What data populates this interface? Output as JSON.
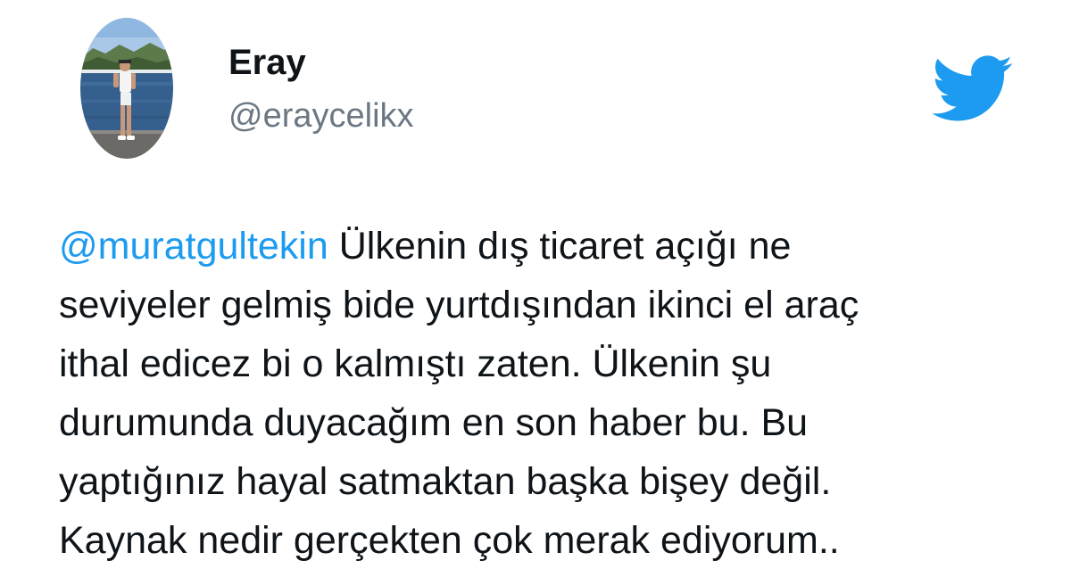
{
  "author": {
    "display_name": "Eray",
    "handle": "@eraycelikx",
    "avatar": "profile-photo"
  },
  "logo": {
    "icon": "twitter-bird-icon",
    "color": "#1d9bf0"
  },
  "tweet": {
    "mention": "@muratgultekin",
    "mention_color": "#1d9bf0",
    "lines": [
      " Ülkenin dış ticaret açığı ne",
      "seviyeler gelmiş bide yurtdışından ikinci el araç",
      "ithal edicez bi o kalmıştı zaten. Ülkenin şu",
      "durumunda duyacağım en son haber bu. Bu",
      "yaptığınız hayal satmaktan başka bişey değil.",
      "Kaynak nedir gerçekten çok merak ediyorum.."
    ]
  }
}
